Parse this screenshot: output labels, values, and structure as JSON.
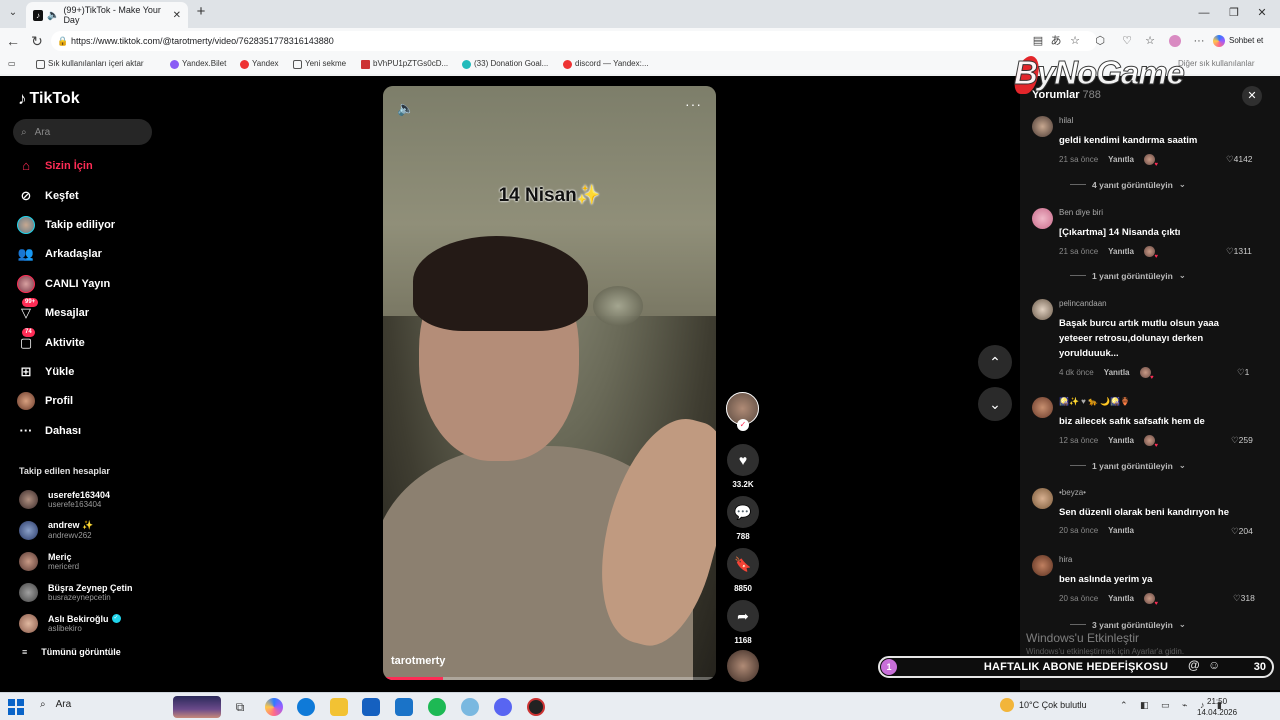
{
  "browser": {
    "tab_title": "(99+)TikTok - Make Your Day",
    "url": "https://www.tiktok.com/@tarotmerty/video/7628351778316143880",
    "copilot_label": "Sohbet et",
    "bookmarks": [
      "Sık kullanılanları içeri aktar",
      "Yandex.Bilet",
      "Yandex",
      "Yeni sekme",
      "bVhPU1pZTGs0cD...",
      "(33) Donation Goal...",
      "discord — Yandex:...",
      "Diğer sık kullanılanlar"
    ]
  },
  "sidebar": {
    "logo": "TikTok",
    "search_placeholder": "Ara",
    "nav": [
      {
        "label": "Sizin İçin",
        "icon": "home-icon"
      },
      {
        "label": "Keşfet",
        "icon": "compass-icon"
      },
      {
        "label": "Takip ediliyor",
        "icon": "following-avatar"
      },
      {
        "label": "Arkadaşlar",
        "icon": "friends-icon"
      },
      {
        "label": "CANLI Yayın",
        "icon": "live-avatar"
      },
      {
        "label": "Mesajlar",
        "icon": "messages-icon",
        "badge": "99+"
      },
      {
        "label": "Aktivite",
        "icon": "activity-icon",
        "badge": "74"
      },
      {
        "label": "Yükle",
        "icon": "upload-icon"
      },
      {
        "label": "Profil",
        "icon": "profile-avatar"
      },
      {
        "label": "Dahası",
        "icon": "more-icon"
      }
    ],
    "following_title": "Takip edilen hesaplar",
    "following": [
      {
        "name": "userefe163404",
        "handle": "userefe163404"
      },
      {
        "name": "andrew ✨",
        "handle": "andrewv262"
      },
      {
        "name": "Meriç",
        "handle": "mericerd"
      },
      {
        "name": "Büşra Zeynep Çetin",
        "handle": "busrazeynepcetin"
      },
      {
        "name": "Aslı Bekiroğlu",
        "handle": "aslibekiro",
        "verified": true
      }
    ],
    "see_all": "Tümünü görüntüle"
  },
  "video": {
    "caption": "14 Nisan✨",
    "author": "tarotmerty",
    "progress": 0.18,
    "likes": "33.2K",
    "comments": "788",
    "saves": "8850",
    "shares": "1168"
  },
  "comments_panel": {
    "title": "Yorumlar",
    "count": "788",
    "reply_label": "Yanıtla",
    "items": [
      {
        "user": "hilal",
        "text": "geldi kendimi kandırma saatim",
        "time": "21 sa önce",
        "likes": "4142",
        "replies": "4 yanıt görüntüleyin"
      },
      {
        "user": "Ben diye biri",
        "text": "[Çıkartma] 14 Nisanda çıktı",
        "time": "21 sa önce",
        "likes": "1311",
        "replies": "1 yanıt görüntüleyin"
      },
      {
        "user": "pelincandaan",
        "text": "Başak burcu artık mutlu olsun yaaa yeteeer retrosu,dolunayı derken yorulduuuk...",
        "time": "4 dk önce",
        "likes": "1",
        "replies": ""
      },
      {
        "user": "🎑✨ ♥ 🐆 🌙🎑🏺",
        "text": "biz ailecek safık safsafık hem de",
        "time": "12 sa önce",
        "likes": "259",
        "replies": "1 yanıt görüntüleyin"
      },
      {
        "user": "•beyza•",
        "text": "Sen düzenli olarak beni kandırıyon he",
        "time": "20 sa önce",
        "likes": "204",
        "replies": ""
      },
      {
        "user": "hira",
        "text": "ben aslında yerim ya",
        "time": "20 sa önce",
        "likes": "318",
        "replies": "3 yanıt görüntüleyin"
      }
    ]
  },
  "overlays": {
    "watermark": "ByNoGame",
    "activate_title": "Windows'u Etkinleştir",
    "activate_sub": "Windows'u etkinleştirmek için Ayarlar'a gidin.",
    "goal_left": "1",
    "goal_text": "HAFTALIK ABONE HEDEFİŞKOSU",
    "goal_right": "30"
  },
  "taskbar": {
    "search": "Ara",
    "weather": "10°C  Çok bulutlu",
    "time": "21:50",
    "date": "14.04.2026"
  }
}
